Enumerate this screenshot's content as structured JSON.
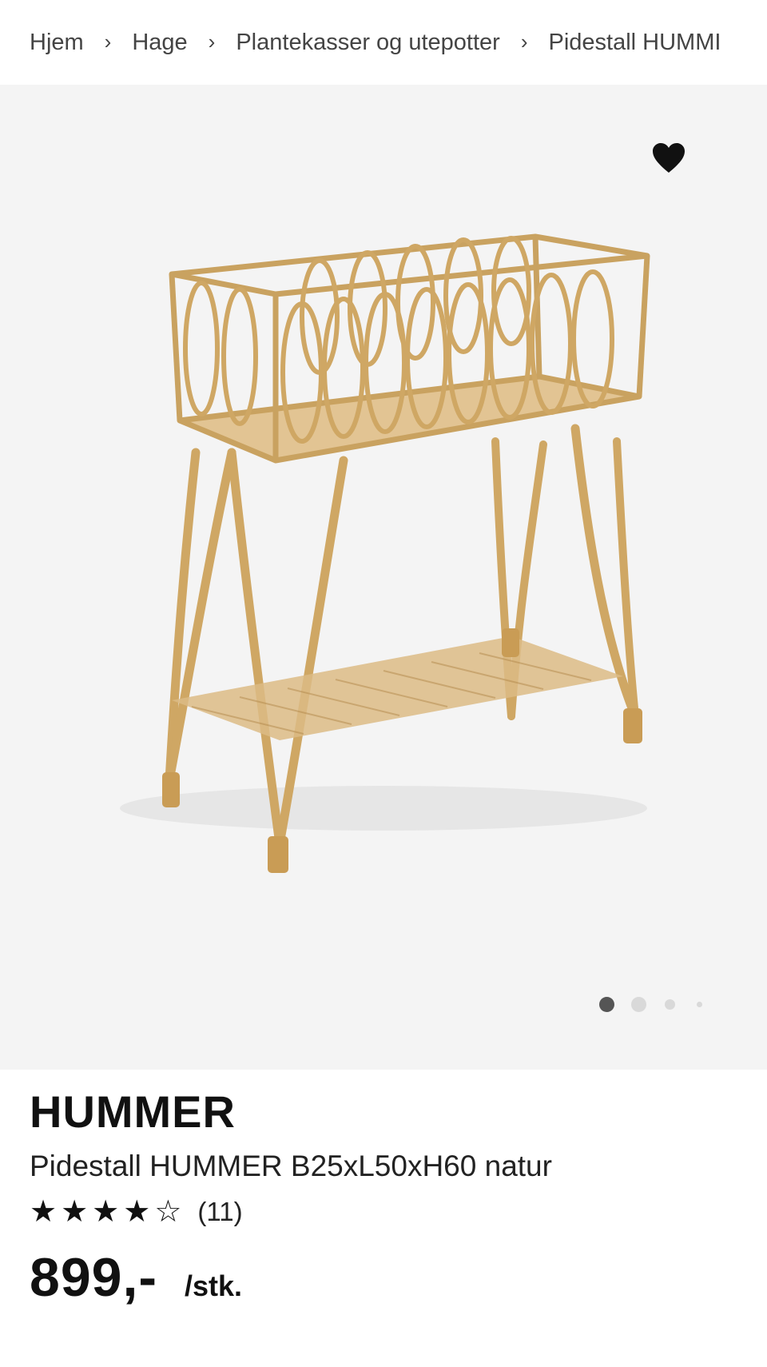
{
  "breadcrumb": {
    "items": [
      "Hjem",
      "Hage",
      "Plantekasser og utepotter",
      "Pidestall HUMMI"
    ],
    "separator": "›"
  },
  "media": {
    "background": "#f4f4f4",
    "favorite_icon": "heart-icon",
    "carousel_total": 4,
    "carousel_active": 1,
    "product_color": "#d7b57c"
  },
  "product": {
    "brand": "HUMMER",
    "name": "Pidestall HUMMER B25xL50xH60 natur",
    "rating": 4,
    "rating_max": 5,
    "review_count": "(11)",
    "price": "899,-",
    "unit": "/stk."
  }
}
